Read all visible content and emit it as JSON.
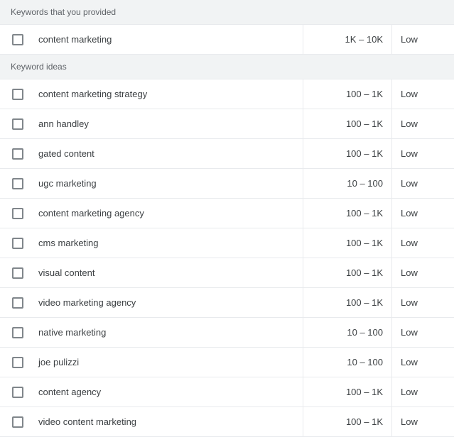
{
  "sections": {
    "provided": {
      "title": "Keywords that you provided",
      "rows": [
        {
          "keyword": "content marketing",
          "volume": "1K – 10K",
          "competition": "Low"
        }
      ]
    },
    "ideas": {
      "title": "Keyword ideas",
      "rows": [
        {
          "keyword": "content marketing strategy",
          "volume": "100 – 1K",
          "competition": "Low"
        },
        {
          "keyword": "ann handley",
          "volume": "100 – 1K",
          "competition": "Low"
        },
        {
          "keyword": "gated content",
          "volume": "100 – 1K",
          "competition": "Low"
        },
        {
          "keyword": "ugc marketing",
          "volume": "10 – 100",
          "competition": "Low"
        },
        {
          "keyword": "content marketing agency",
          "volume": "100 – 1K",
          "competition": "Low"
        },
        {
          "keyword": "cms marketing",
          "volume": "100 – 1K",
          "competition": "Low"
        },
        {
          "keyword": "visual content",
          "volume": "100 – 1K",
          "competition": "Low"
        },
        {
          "keyword": "video marketing agency",
          "volume": "100 – 1K",
          "competition": "Low"
        },
        {
          "keyword": "native marketing",
          "volume": "10 – 100",
          "competition": "Low"
        },
        {
          "keyword": "joe pulizzi",
          "volume": "10 – 100",
          "competition": "Low"
        },
        {
          "keyword": "content agency",
          "volume": "100 – 1K",
          "competition": "Low"
        },
        {
          "keyword": "video content marketing",
          "volume": "100 – 1K",
          "competition": "Low"
        }
      ]
    }
  }
}
